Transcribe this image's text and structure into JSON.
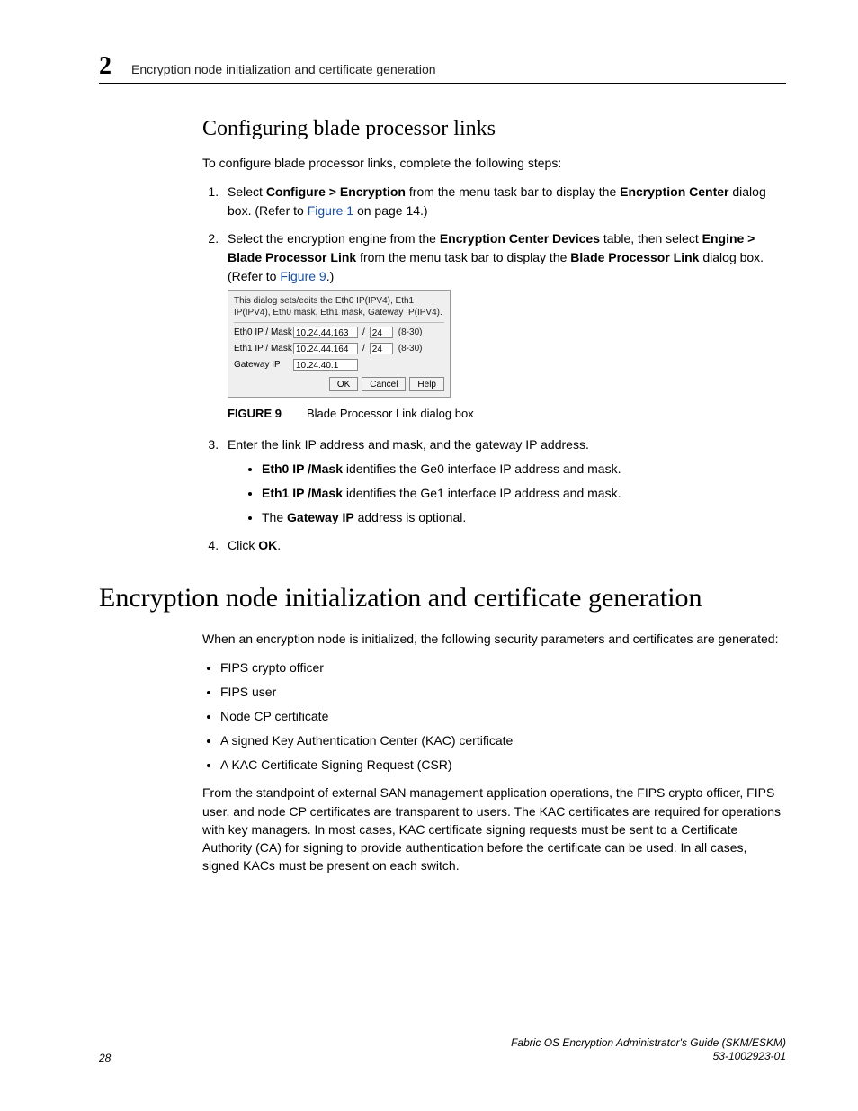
{
  "header": {
    "chapter_number": "2",
    "running_title": "Encryption node initialization and certificate generation"
  },
  "section1": {
    "title": "Configuring blade processor links",
    "intro": "To configure blade processor links, complete the following steps:",
    "step1_pre": "Select ",
    "step1_bold": "Configure > Encryption",
    "step1_mid": " from the menu task bar to display the ",
    "step1_bold2": "Encryption Center",
    "step1_post": " dialog box. (Refer to ",
    "step1_link": "Figure 1",
    "step1_end": " on page 14.)",
    "step2_pre": "Select the encryption engine from the ",
    "step2_b1": "Encryption Center Devices",
    "step2_mid1": " table, then select ",
    "step2_b2": "Engine > Blade Processor Link",
    "step2_mid2": " from the menu task bar to display the ",
    "step2_b3": "Blade Processor Link",
    "step2_post": " dialog box. (Refer to ",
    "step2_link": "Figure 9",
    "step2_end": ".)",
    "step3": "Enter the link IP address and mask, and the gateway IP address.",
    "bullet_a_b": "Eth0 IP /Mask",
    "bullet_a_t": " identifies the Ge0 interface IP address and mask.",
    "bullet_b_b": "Eth1 IP /Mask",
    "bullet_b_t": " identifies the Ge1 interface IP address and mask.",
    "bullet_c_pre": "The ",
    "bullet_c_b": "Gateway IP",
    "bullet_c_t": " address is optional.",
    "step4_pre": "Click ",
    "step4_b": "OK",
    "step4_post": "."
  },
  "dialog": {
    "desc": "This dialog sets/edits the Eth0 IP(IPV4), Eth1 IP(IPV4), Eth0 mask, Eth1 mask, Gateway IP(IPV4).",
    "row_eth0_label": "Eth0 IP / Mask",
    "row_eth0_ip": "10.24.44.163",
    "row_eth0_mask": "24",
    "row_eth1_label": "Eth1 IP / Mask",
    "row_eth1_ip": "10.24.44.164",
    "row_eth1_mask": "24",
    "mask_range": "(8-30)",
    "row_gw_label": "Gateway IP",
    "row_gw_ip": "10.24.40.1",
    "btn_ok": "OK",
    "btn_cancel": "Cancel",
    "btn_help": "Help"
  },
  "figure": {
    "label": "FIGURE 9",
    "caption": "Blade Processor Link dialog box"
  },
  "section2": {
    "title": "Encryption node initialization and certificate generation",
    "intro": "When an encryption node is initialized, the following security parameters and certificates are generated:",
    "bullets": {
      "b1": "FIPS crypto officer",
      "b2": "FIPS user",
      "b3": "Node CP certificate",
      "b4": "A signed Key Authentication Center (KAC) certificate",
      "b5": "A KAC Certificate Signing Request (CSR)"
    },
    "para2": "From the standpoint of external SAN management application operations, the FIPS crypto officer, FIPS user, and node CP certificates are transparent to users. The KAC certificates are required for operations with key managers. In most cases, KAC certificate signing requests must be sent to a Certificate Authority (CA) for signing to provide authentication before the certificate can be used. In all cases, signed KACs must be present on each switch."
  },
  "footer": {
    "page": "28",
    "pub_title": "Fabric OS Encryption Administrator's Guide (SKM/ESKM)",
    "pub_id": "53-1002923-01"
  }
}
